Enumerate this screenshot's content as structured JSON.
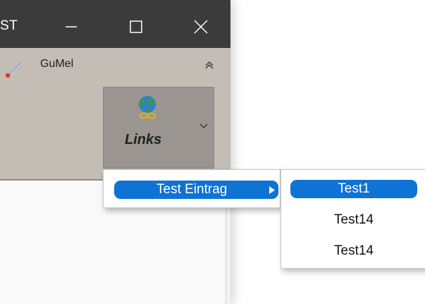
{
  "window": {
    "title_fragment": "ST",
    "controls": {
      "minimize": "minimize",
      "maximize": "maximize",
      "close": "close"
    }
  },
  "ribbon": {
    "tab_label": "GuMel",
    "links_button_label": "Links"
  },
  "menu": {
    "item": "Test Eintrag",
    "submenu": [
      "Test1",
      "Test14",
      "Test14"
    ]
  },
  "colors": {
    "titlebar": "#3b3b3b",
    "ribbon": "#c3bdb6",
    "links_button": "#9a9590",
    "highlight": "#0f73d6"
  }
}
